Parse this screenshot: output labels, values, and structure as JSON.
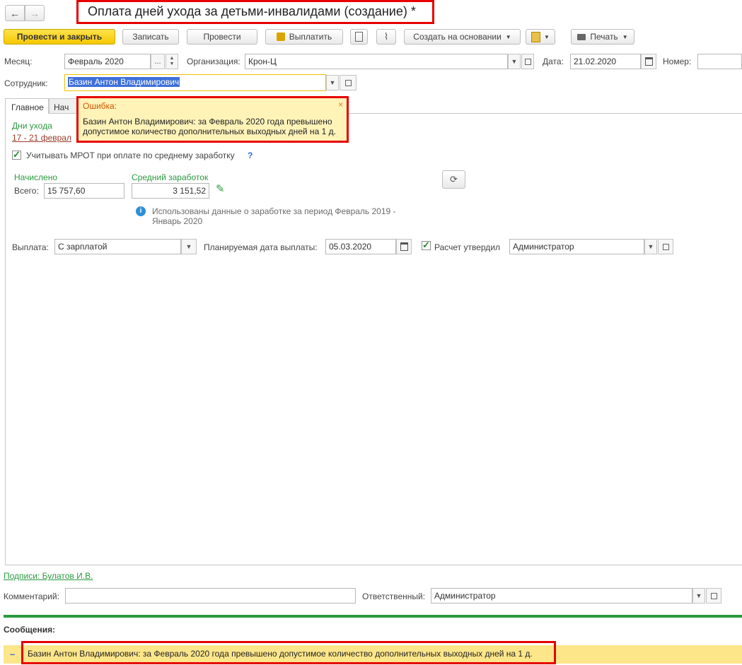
{
  "nav": {
    "back_icon": "←",
    "forward_icon": "→"
  },
  "title": "Оплата дней ухода за детьми-инвалидами (создание) *",
  "toolbar": {
    "post_close": "Провести и закрыть",
    "save": "Записать",
    "post": "Провести",
    "pay": "Выплатить",
    "create_based": "Создать на основании",
    "print": "Печать"
  },
  "header": {
    "month_label": "Месяц:",
    "month_value": "Февраль 2020",
    "month_dots": "...",
    "org_label": "Организация:",
    "org_value": "Крон-Ц",
    "date_label": "Дата:",
    "date_value": "21.02.2020",
    "number_label": "Номер:",
    "employee_label": "Сотрудник:",
    "employee_value": "Базин Антон Владимирович"
  },
  "tabs": [
    {
      "label": "Главное"
    },
    {
      "label": "Нач"
    }
  ],
  "tooltip": {
    "title": "Ошибка:",
    "text": "Базин Антон Владимирович: за Февраль 2020 года превышено допустимое количество дополнительных выходных дней на 1 д."
  },
  "main": {
    "care_days_label": "Дни ухода",
    "care_days_link": "17 - 21 феврал",
    "mrot_label": "Учитывать МРОТ при оплате по среднему заработку",
    "mrot_help": "?",
    "accrued_label": "Начислено",
    "total_label": "Всего:",
    "total_value": "15 757,60",
    "avg_label": "Средний заработок",
    "avg_value": "3 151,52",
    "info_text_1": "Использованы данные о заработке за период Февраль 2019 -",
    "info_text_2": "Январь 2020",
    "payout_label": "Выплата:",
    "payout_value": "С зарплатой",
    "plan_date_label": "Планируемая дата выплаты:",
    "plan_date_value": "05.03.2020",
    "approved_label": "Расчет утвердил",
    "approved_value": "Администратор"
  },
  "footer": {
    "signatures_link": "Подписи: Булатов И.В.",
    "comment_label": "Комментарий:",
    "responsible_label": "Ответственный:",
    "responsible_value": "Администратор"
  },
  "messages": {
    "header": "Сообщения:",
    "collapse": "–",
    "text": "Базин Антон Владимирович: за Февраль 2020 года превышено допустимое количество дополнительных выходных дней на 1 д."
  },
  "colors": {
    "accent_green": "#2b9a3f",
    "error_red": "#e60000",
    "primary_yellow": "#f5c800",
    "tooltip_bg": "#fff3b8"
  }
}
